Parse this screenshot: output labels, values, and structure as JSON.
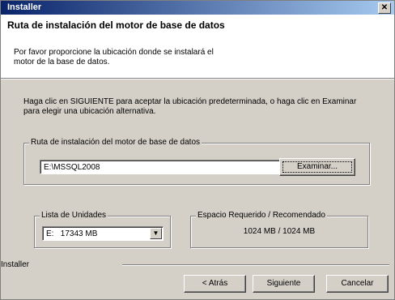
{
  "window": {
    "title": "Installer",
    "close_glyph": "✕"
  },
  "header": {
    "title": "Ruta de instalación del motor de base de datos",
    "subtitle": "Por favor proporcione la ubicación donde se instalará el motor de la base de datos."
  },
  "intro": "Haga clic en SIGUIENTE para aceptar la ubicación predeterminada, o haga clic en Examinar para elegir una ubicación alternativa.",
  "path_group": {
    "label": "Ruta de instalación del motor de base de datos",
    "value": "E:\\MSSQL2008",
    "browse_label": "Examinar..."
  },
  "drives_group": {
    "label": "Lista de Unidades",
    "selected": "E:   17343 MB",
    "arrow_glyph": "▼"
  },
  "space_group": {
    "label": "Espacio Requerido / Recomendado",
    "value": "1024 MB / 1024 MB"
  },
  "footer": {
    "label": "Installer",
    "back_label": "< Atrás",
    "next_label": "Siguiente",
    "cancel_label": "Cancelar"
  }
}
